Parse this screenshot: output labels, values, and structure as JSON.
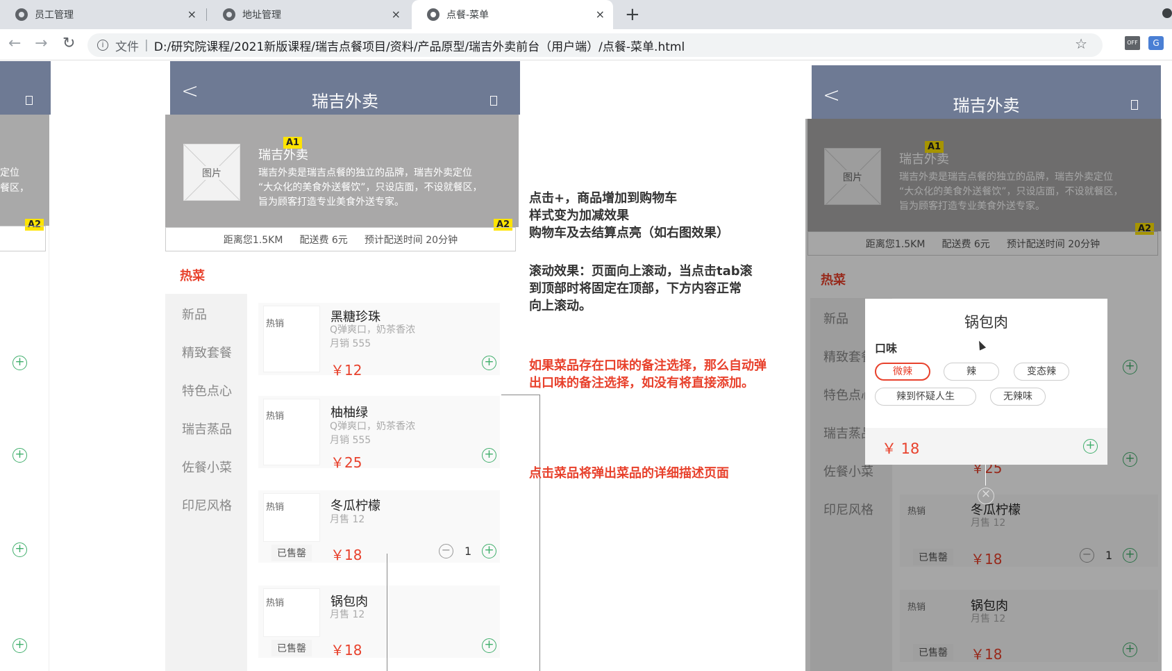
{
  "browser": {
    "tabs": [
      {
        "title": "员工管理",
        "close": "×"
      },
      {
        "title": "地址管理",
        "close": "×"
      },
      {
        "title": "点餐-菜单",
        "close": "×"
      }
    ],
    "new_tab": "+",
    "address": {
      "scheme_label": "文件",
      "path": "D:/研究院课程/2021新版课程/瑞吉点餐项目/资料/产品原型/瑞吉外卖前台（用户端）/点餐-菜单.html"
    },
    "ext_off_label": "OFF"
  },
  "left_partial": {
    "banner_text": [
      "卖定位",
      "就餐区，"
    ],
    "badge": "A2"
  },
  "app": {
    "title": "瑞吉外卖",
    "image_placeholder": "图片",
    "shop_name": "瑞吉外卖",
    "badge_a1": "A1",
    "badge_a2": "A2",
    "shop_desc": [
      "瑞吉外卖是瑞吉点餐的独立的品牌，瑞吉外卖定位",
      "“大众化的美食外送餐饮”，只设店面，不设就餐区，",
      "旨为顾客打造专业美食外送专家。"
    ],
    "info": {
      "distance": "距离您1.5KM",
      "fee": "配送费 6元",
      "eta": "预计配送时间 20分钟"
    },
    "active_category": "热菜",
    "categories": [
      "新品",
      "精致套餐",
      "特色点心",
      "瑞吉蒸品",
      "佐餐小菜",
      "印尼风格"
    ],
    "dishes": [
      {
        "tag": "热销",
        "name": "黑糖珍珠",
        "desc": "Q弹爽口，奶茶香浓",
        "sales": "月销 555",
        "price": "￥12"
      },
      {
        "tag": "热销",
        "name": "柚柚绿",
        "desc": "Q弹爽口，奶茶香浓",
        "sales": "月销 555",
        "price": "￥25"
      },
      {
        "tag": "热销",
        "name": "冬瓜柠檬",
        "sales": "月售 12",
        "soldout": "已售罄",
        "price": "￥18",
        "qty": "1"
      },
      {
        "tag": "热销",
        "name": "锅包肉",
        "sales": "月售 12",
        "soldout": "已售罄",
        "price": "￥18"
      }
    ]
  },
  "annotations": {
    "add_cart": [
      "点击+，商品增加到购物车",
      "样式变为加减效果",
      "购物车及去结算点亮（如右图效果）"
    ],
    "scroll": [
      "滚动效果：页面向上滚动，当点击tab滚",
      "到顶部时将固定在顶部，下方内容正常",
      "向上滚动。"
    ],
    "flavor": [
      "如果菜品存在口味的备注选择，那么自动弹",
      "出口味的备注选择，如没有将直接添加。"
    ],
    "detail": "点击菜品将弹出菜品的详细描述页面"
  },
  "popup": {
    "title": "锅包肉",
    "label": "口味",
    "options": [
      "微辣",
      "辣",
      "变态辣",
      "辣到怀疑人生",
      "无辣味"
    ],
    "selected": "微辣",
    "price": "￥ 18"
  },
  "right_phone": {
    "partial_price": "￥25",
    "dishes": [
      {
        "tag": "热销",
        "name": "冬瓜柠檬",
        "sales": "月售 12",
        "soldout": "已售罄",
        "price": "￥18",
        "qty": "1"
      },
      {
        "tag": "热销",
        "name": "锅包肉",
        "sales": "月售 12",
        "soldout": "已售罄",
        "price": "￥18"
      }
    ]
  }
}
